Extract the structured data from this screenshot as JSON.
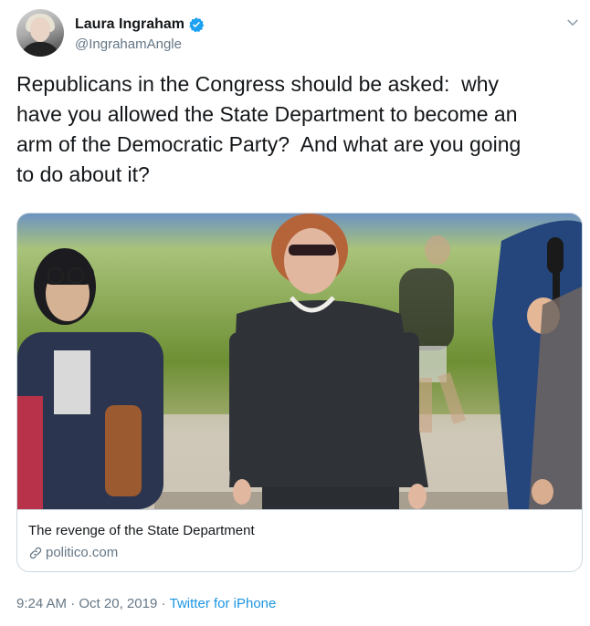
{
  "author": {
    "name": "Laura Ingraham",
    "handle": "@IngrahamAngle"
  },
  "tweet": {
    "text": "Republicans in the Congress should be asked:  why\nhave you allowed the State Department to become an\narm of the Democratic Party?  And what are you going\nto do about it?"
  },
  "card": {
    "title": "The revenge of the State Department",
    "domain": "politico.com"
  },
  "footer": {
    "time": "9:24 AM",
    "separator": " · ",
    "date": "Oct 20, 2019",
    "separator2": " · ",
    "source": "Twitter for iPhone"
  },
  "colors": {
    "verified": "#1da1f2",
    "link": "#1b95e0",
    "secondary_text": "#657786",
    "border": "#ccd6dd"
  },
  "icons": [
    "verified-badge-icon",
    "chevron-down-icon",
    "link-icon"
  ]
}
